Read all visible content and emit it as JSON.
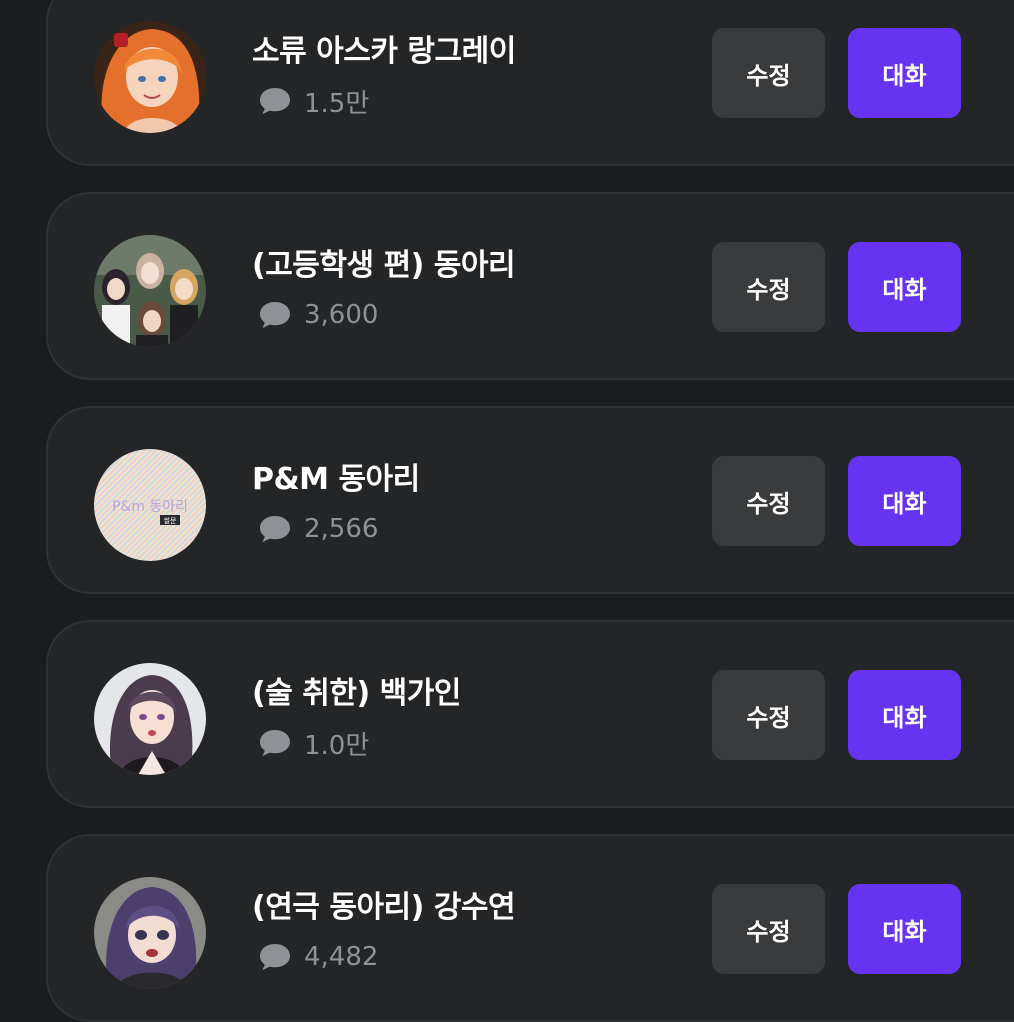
{
  "characters": [
    {
      "name": "소류 아스카 랑그레이",
      "count": "1.5만",
      "edit_label": "수정",
      "chat_label": "대화",
      "avatar_icon": "anime-girl-orange-hair-avatar"
    },
    {
      "name": "(고등학생 편) 동아리",
      "count": "3,600",
      "edit_label": "수정",
      "chat_label": "대화",
      "avatar_icon": "group-of-students-avatar"
    },
    {
      "name": "P&M 동아리",
      "count": "2,566",
      "edit_label": "수정",
      "chat_label": "대화",
      "avatar_icon": "pastel-logo-avatar",
      "avatar_text": "P&m 동아리",
      "avatar_badge": "썰문"
    },
    {
      "name": "(술 취한) 백가인",
      "count": "1.0만",
      "edit_label": "수정",
      "chat_label": "대화",
      "avatar_icon": "anime-girl-dark-hair-avatar"
    },
    {
      "name": "(연극 동아리) 강수연",
      "count": "4,482",
      "edit_label": "수정",
      "chat_label": "대화",
      "avatar_icon": "anime-girl-purple-hair-avatar"
    }
  ],
  "colors": {
    "background": "#1b1c1d",
    "card": "#242526",
    "edit_button": "#3a3b3d",
    "chat_button": "#6633f2",
    "count_text": "#8e9196"
  },
  "icons": {
    "comment": "speech-bubble-icon"
  }
}
